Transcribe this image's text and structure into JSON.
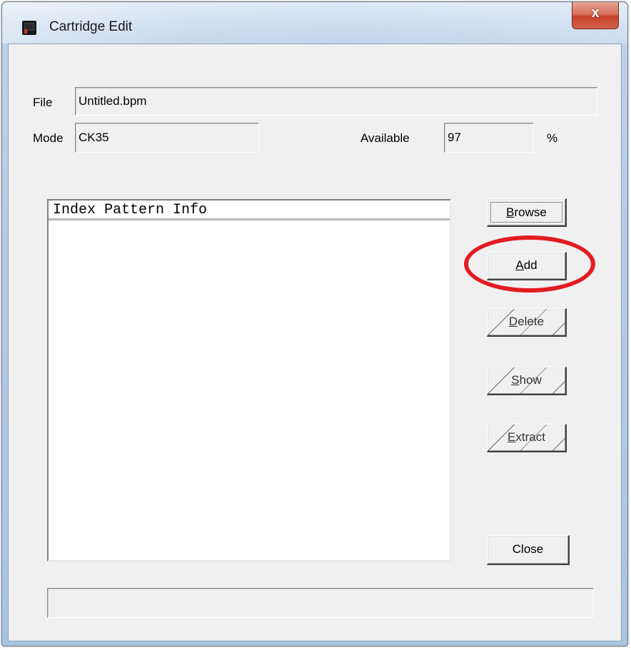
{
  "window": {
    "title": "Cartridge Edit",
    "close_glyph": "x",
    "icon": "cartridge-app-icon"
  },
  "file": {
    "label": "File",
    "value": "Untitled.bpm"
  },
  "mode": {
    "label": "Mode",
    "value": "CK35"
  },
  "available": {
    "label": "Available",
    "value": "97",
    "unit": "%"
  },
  "list": {
    "header": "Index Pattern Info",
    "items": []
  },
  "buttons": {
    "browse": {
      "prefix": "",
      "mnemonic": "B",
      "rest": "rowse",
      "enabled": true
    },
    "add": {
      "prefix": "",
      "mnemonic": "A",
      "rest": "dd",
      "enabled": true
    },
    "delete": {
      "prefix": "",
      "mnemonic": "D",
      "rest": "elete",
      "enabled": false
    },
    "show": {
      "prefix": "",
      "mnemonic": "S",
      "rest": "how",
      "enabled": false
    },
    "extract": {
      "prefix": "",
      "mnemonic": "E",
      "rest": "xtract",
      "enabled": false
    },
    "close": {
      "label": "Close",
      "enabled": true
    }
  },
  "status_bar": {
    "text": ""
  },
  "annotation": {
    "color": "#e31b23",
    "target": "add-button"
  }
}
